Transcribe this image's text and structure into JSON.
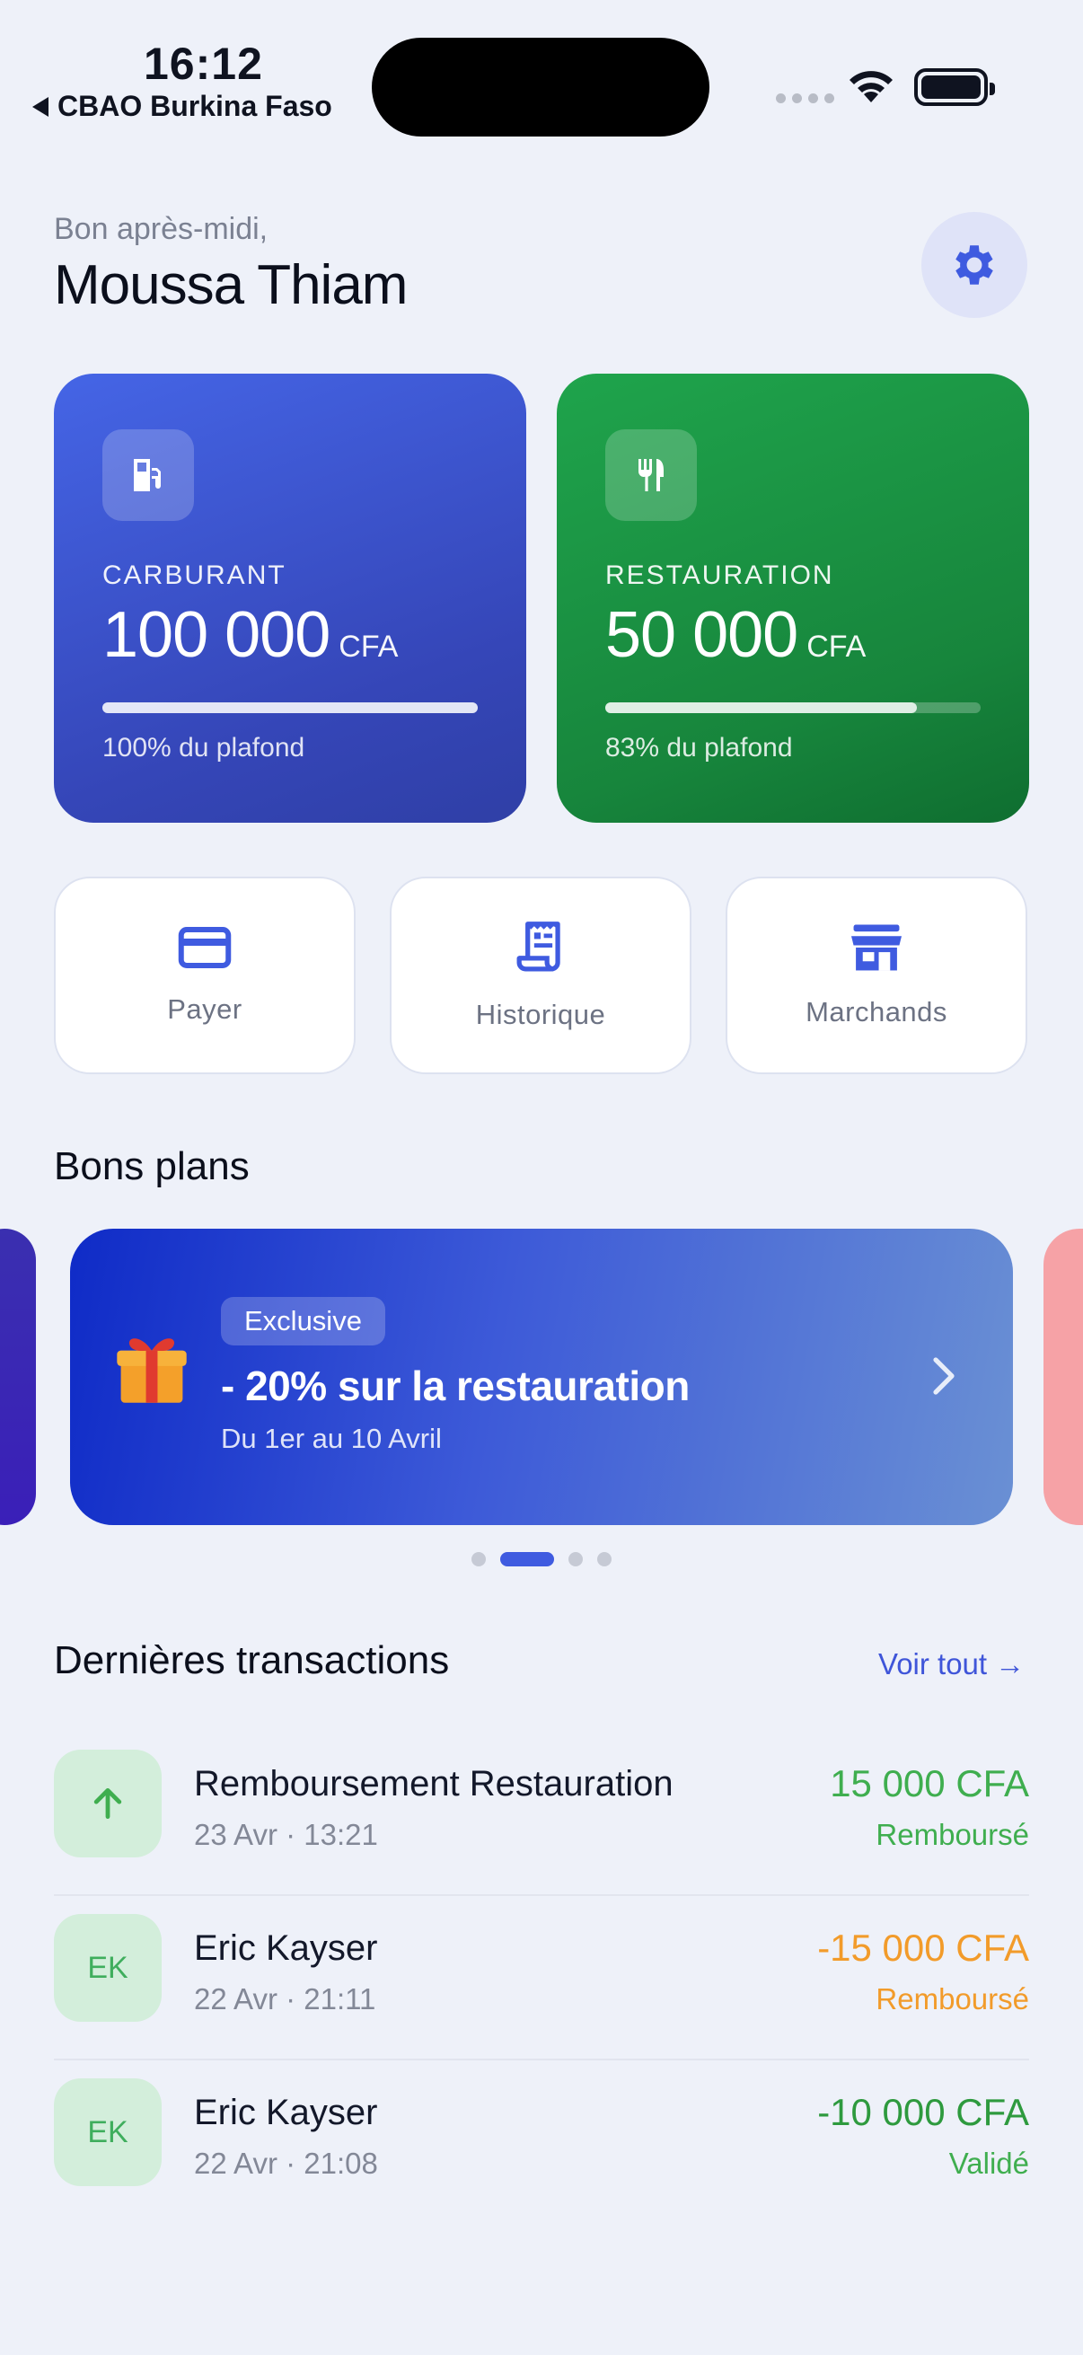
{
  "status_bar": {
    "time": "16:12",
    "back_app": "CBAO Burkina Faso"
  },
  "header": {
    "greeting": "Bon après-midi,",
    "user_name": "Moussa Thiam",
    "settings_icon": "gear-icon"
  },
  "wallets": [
    {
      "label": "CARBURANT",
      "amount": "100 000",
      "currency": "CFA",
      "progress": 1.0,
      "progress_text": "100% du plafond",
      "icon": "fuel-pump-icon",
      "color": "#3d55d6"
    },
    {
      "label": "RESTAURATION",
      "amount": "50 000",
      "currency": "CFA",
      "progress": 0.83,
      "progress_text": "83% du plafond",
      "icon": "fork-knife-icon",
      "color": "#1a9444"
    }
  ],
  "actions": [
    {
      "label": "Payer",
      "icon": "credit-card-icon"
    },
    {
      "label": "Historique",
      "icon": "receipt-icon"
    },
    {
      "label": "Marchands",
      "icon": "storefront-icon"
    }
  ],
  "deals": {
    "title": "Bons plans",
    "active_index": 1,
    "total": 4,
    "current": {
      "badge": "Exclusive",
      "title": "- 20% sur la restauration",
      "subtitle": "Du 1er au 10 Avril",
      "icon": "gift-icon"
    }
  },
  "transactions": {
    "title": "Dernières transactions",
    "see_all": "Voir tout →",
    "items": [
      {
        "avatar": "↑",
        "avatar_icon": "arrow-up-icon",
        "name": "Remboursement Restauration",
        "date": "23 Avr · 13:21",
        "amount": "15 000 CFA",
        "status": "Remboursé",
        "color": "#3fae4f"
      },
      {
        "avatar": "EK",
        "name": "Eric Kayser",
        "date": "22 Avr · 21:11",
        "amount": "-15 000 CFA",
        "status": "Remboursé",
        "color": "#f29b2a"
      },
      {
        "avatar": "EK",
        "name": "Eric Kayser",
        "date": "22 Avr · 21:08",
        "amount": "-10 000 CFA",
        "status": "Validé",
        "color": "#2e9a3e"
      }
    ]
  }
}
